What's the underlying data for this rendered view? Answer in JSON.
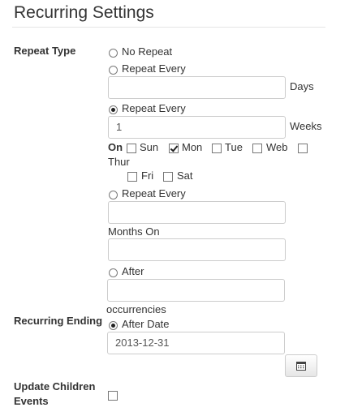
{
  "title": "Recurring Settings",
  "repeat_type": {
    "label": "Repeat Type",
    "no_repeat": {
      "label": "No Repeat",
      "selected": false
    },
    "days": {
      "label": "Repeat Every",
      "value": "",
      "unit": "Days",
      "selected": false
    },
    "weeks": {
      "label": "Repeat Every",
      "value": "1",
      "unit": "Weeks",
      "selected": true,
      "on_label": "On",
      "days": [
        {
          "label": "Sun",
          "checked": false
        },
        {
          "label": "Mon",
          "checked": true
        },
        {
          "label": "Tue",
          "checked": false
        },
        {
          "label": "Web",
          "checked": false
        },
        {
          "label": "Thur",
          "checked": false
        },
        {
          "label": "Fri",
          "checked": false
        },
        {
          "label": "Sat",
          "checked": false
        }
      ]
    },
    "months": {
      "label": "Repeat Every",
      "value": "",
      "months_on_label": "Months On",
      "months_on_value": "",
      "selected": false
    },
    "after": {
      "label": "After",
      "value": "",
      "unit": "occurrencies",
      "selected": false
    }
  },
  "recurring_ending": {
    "label": "Recurring Ending",
    "after_date": {
      "label": "After Date",
      "value": "2013-12-31",
      "selected": true
    },
    "calendar_icon": "calendar-icon"
  },
  "update_children": {
    "label": "Update Children Events",
    "checked": false
  }
}
